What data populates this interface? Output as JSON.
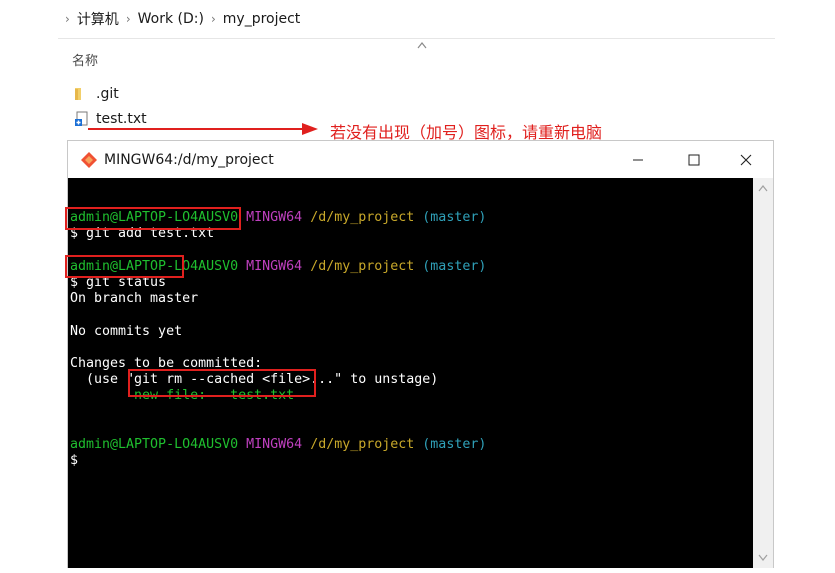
{
  "breadcrumb": {
    "items": [
      "计算机",
      "Work (D:)",
      "my_project"
    ]
  },
  "explorer": {
    "column_name": "名称",
    "files": [
      {
        "name": ".git",
        "icon": "folder-icon"
      },
      {
        "name": "test.txt",
        "icon": "text-file-icon"
      }
    ]
  },
  "annotation": {
    "text": "若没有出现（加号）图标，请重新电脑",
    "color": "#e0201e"
  },
  "window": {
    "title": "MINGW64:/d/my_project",
    "buttons": [
      "minimize",
      "maximize",
      "close"
    ]
  },
  "terminal": {
    "user_host": "admin@LAPTOP-LO4AUSV0",
    "env": "MINGW64",
    "path": "/d/my_project",
    "branch": "(master)",
    "cmd1": "$ git add test.txt",
    "cmd2": "$ git status",
    "out1": "On branch master",
    "out2": "No commits yet",
    "out3": "Changes to be committed:",
    "out4": "  (use \"git rm --cached <file>...\" to unstage)",
    "out5": "        new file:   test.txt",
    "prompt": "$"
  },
  "colors": {
    "green": "#1fbf2f",
    "magenta": "#bf40bf",
    "yellow": "#c8a82a",
    "cyan": "#2fa0b8",
    "highlight": "#e0201e"
  }
}
